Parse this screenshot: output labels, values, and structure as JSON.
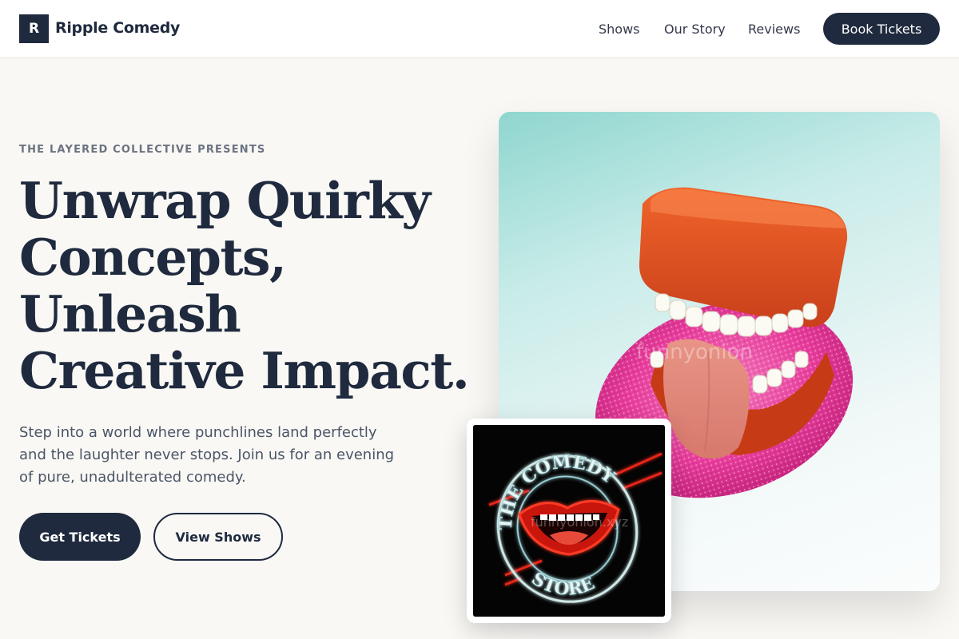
{
  "header": {
    "logo_letter": "R",
    "brand": "Ripple Comedy",
    "nav": [
      "Shows",
      "Our Story",
      "Reviews"
    ],
    "cta": "Book Tickets"
  },
  "hero": {
    "eyebrow": "THE LAYERED COLLECTIVE PRESENTS",
    "headline_lines": [
      "Unwrap Quirky",
      "Concepts,",
      "Unleash",
      "Creative Impact."
    ],
    "lede": "Step into a world where punchlines land perfectly and the laughter never stops. Join us for an evening of pure, unadulterated comedy.",
    "primary_button": "Get Tickets",
    "secondary_button": "View Shows"
  },
  "images": {
    "main_watermark": "funnyonion",
    "small_watermark": "funnyonion.xyz",
    "sign_top": "THE COMEDY",
    "sign_bottom": "STORE"
  },
  "colors": {
    "navy": "#1f2a3e",
    "background": "#f9f8f5",
    "neon_red": "#e8231e",
    "pink": "#e8399a"
  }
}
